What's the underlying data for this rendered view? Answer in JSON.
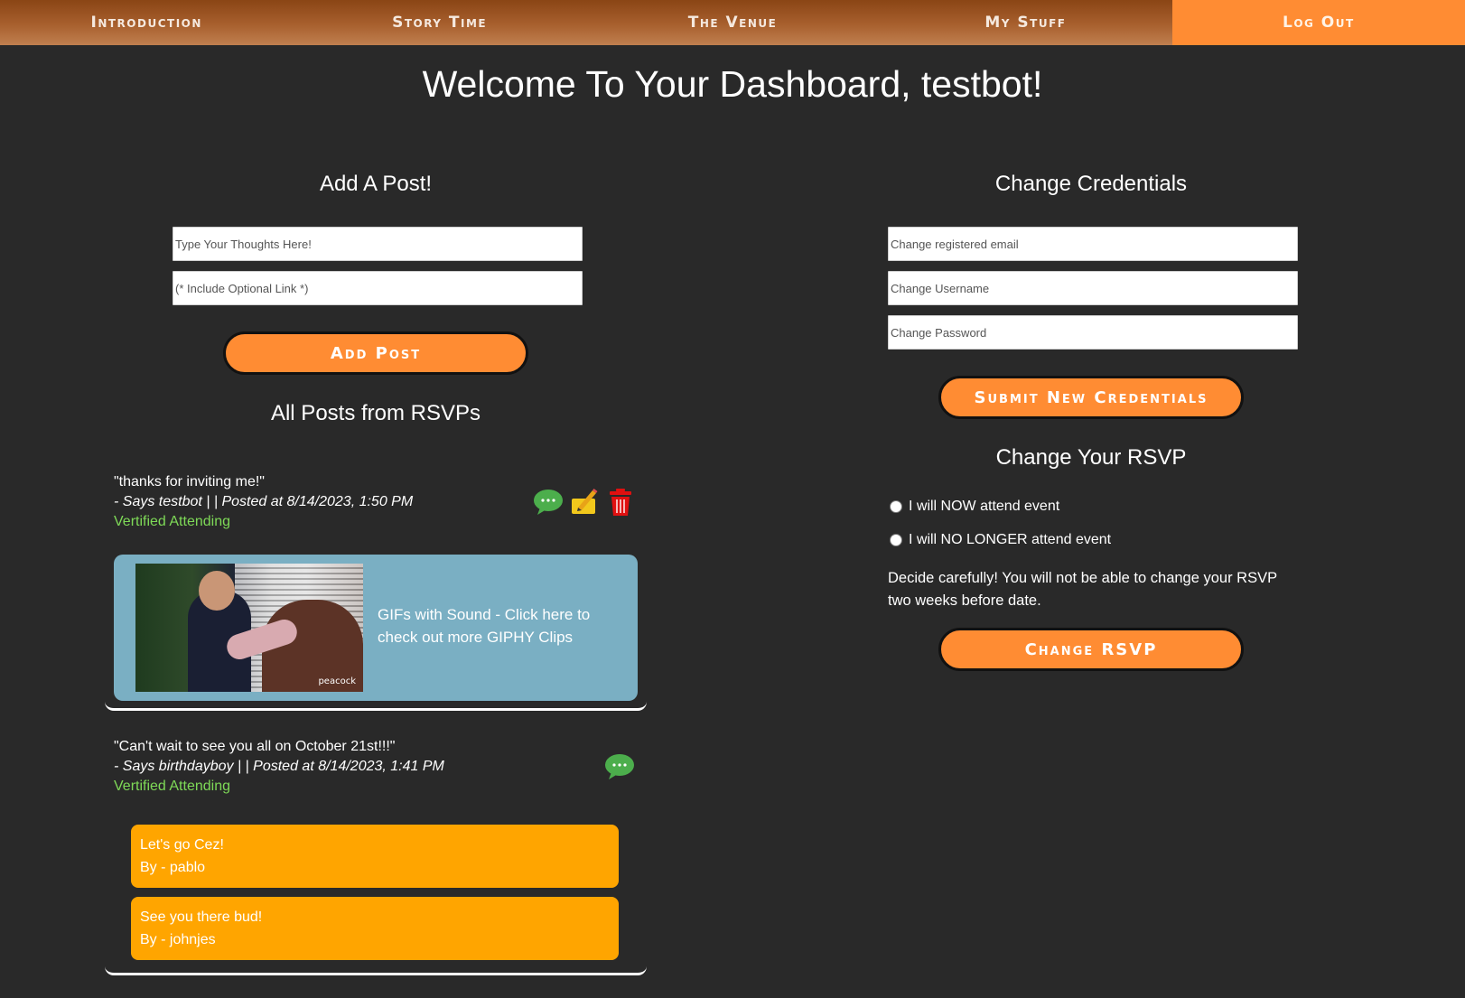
{
  "nav": {
    "items": [
      "Introduction",
      "Story Time",
      "The Venue",
      "My Stuff",
      "Log Out"
    ]
  },
  "page_title": "Welcome To Your Dashboard, testbot!",
  "add_post": {
    "heading": "Add A Post!",
    "thoughts_placeholder": "Type Your Thoughts Here!",
    "link_placeholder": "(* Include Optional Link *)",
    "button_label": "Add Post"
  },
  "posts_section": {
    "heading": "All Posts from RSVPs",
    "posts": [
      {
        "quote": "\"thanks for inviting me!\"",
        "meta": "- Says testbot | | Posted at 8/14/2023, 1:50 PM",
        "status": "Vertified Attending",
        "giphy": {
          "watermark": "peacock",
          "link_text": "GIFs with Sound - Click here to check out more GIPHY Clips"
        }
      },
      {
        "quote": "\"Can't wait to see you all on October 21st!!!\"",
        "meta": "- Says birthdayboy | | Posted at 8/14/2023, 1:41 PM",
        "status": "Vertified Attending",
        "comments": [
          {
            "text": "Let's go Cez!",
            "author": "By - pablo"
          },
          {
            "text": "See you there bud!",
            "author": "By - johnjes"
          }
        ]
      }
    ]
  },
  "credentials": {
    "heading": "Change Credentials",
    "email_placeholder": "Change registered email",
    "username_placeholder": "Change Username",
    "password_placeholder": "Change Password",
    "button_label": "Submit New Credentials"
  },
  "rsvp": {
    "heading": "Change Your RSVP",
    "option_attend": "I will NOW attend event",
    "option_not_attend": "I will NO LONGER attend event",
    "warning": "Decide carefully! You will not be able to change your RSVP two weeks before date.",
    "button_label": "Change RSVP"
  },
  "colors": {
    "accent": "#ff8c33",
    "background": "#292929",
    "attending": "#7ed957",
    "comment_card": "#ffa500",
    "giphy_card": "#7aafc3",
    "delete": "#e01010"
  },
  "icons": [
    "comment-icon",
    "edit-icon",
    "trash-icon"
  ]
}
